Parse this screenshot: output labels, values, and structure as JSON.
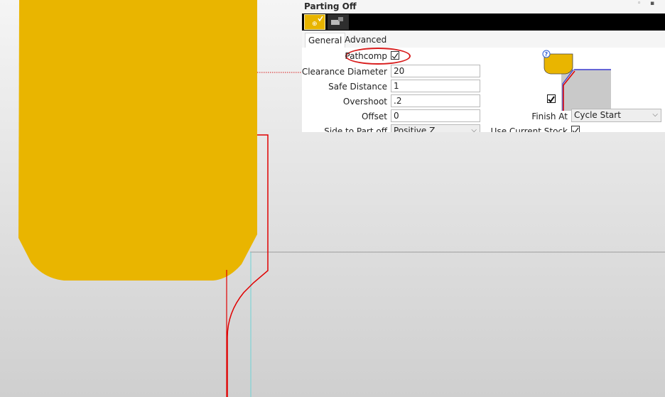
{
  "panel": {
    "title": "Parting Off",
    "pin_glyphs": [
      "◦",
      "▪"
    ]
  },
  "toolbar": {
    "buttons": [
      {
        "name": "turning-op-button",
        "icon": "tool-check-icon"
      },
      {
        "name": "stock-view-button",
        "icon": "stock-icon"
      }
    ]
  },
  "tabs": [
    {
      "label": "General",
      "active": true
    },
    {
      "label": "Advanced",
      "active": false
    }
  ],
  "general": {
    "pathcomp": {
      "label": "Pathcomp",
      "checked": true
    },
    "clearance_diameter": {
      "label": "Clearance Diameter",
      "value": "20"
    },
    "safe_distance": {
      "label": "Safe Distance",
      "value": "1"
    },
    "overshoot": {
      "label": "Overshoot",
      "value": ".2"
    },
    "offset": {
      "label": "Offset",
      "value": "0"
    },
    "side_to_part_off": {
      "label": "Side to Part off",
      "value": "Positive Z"
    },
    "finish_at": {
      "label": "Finish At",
      "value": "Cycle Start"
    },
    "use_current_stock": {
      "label": "Use Current Stock",
      "checked": true
    },
    "preview_checkbox_checked": true
  },
  "colors": {
    "tool": "#e9b500",
    "toolpath": "#e00000",
    "annotation": "#d81c1c",
    "stock_edge": "#6fd3d6"
  }
}
